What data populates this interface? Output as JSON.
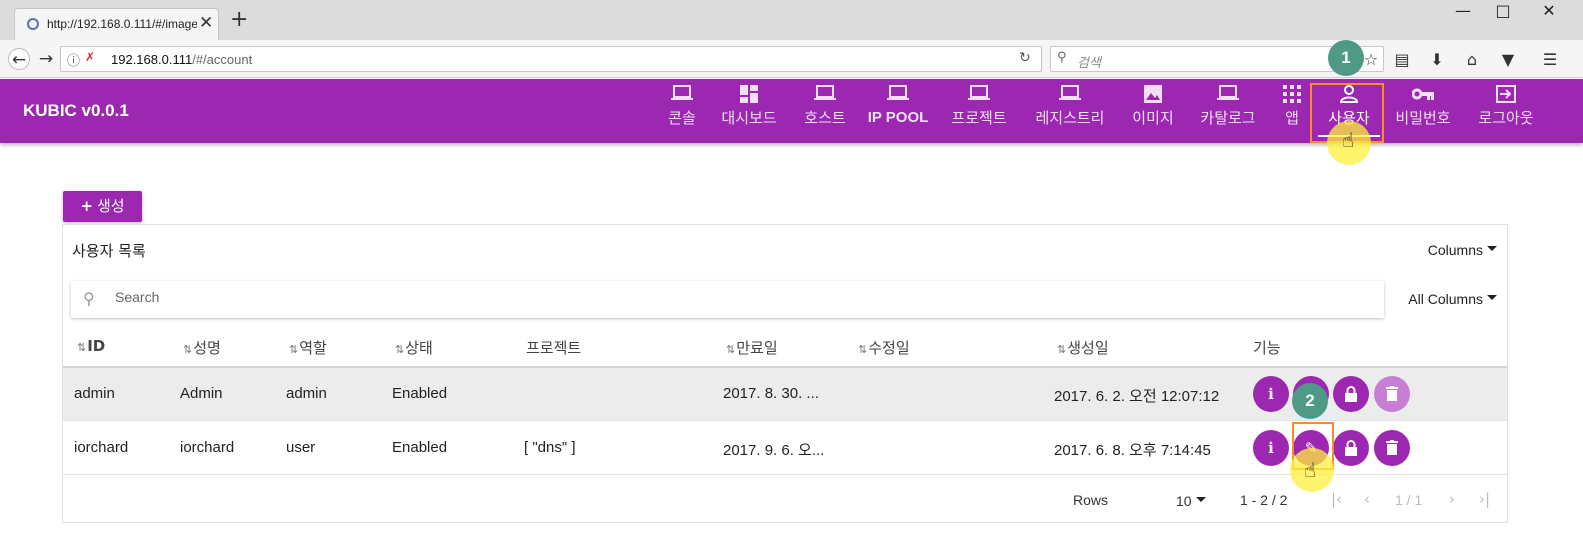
{
  "browser": {
    "tab_title": "http://192.168.0.111/#/image",
    "tab_close": "✕",
    "new_tab": "+",
    "url_host": "192.168.0.111",
    "url_path": "/#/account",
    "search_placeholder": "검색"
  },
  "app": {
    "title": "KUBIC v0.0.1",
    "menu": [
      {
        "label": "콘솔",
        "icon": "laptop-icon"
      },
      {
        "label": "대시보드",
        "icon": "dashboard-icon"
      },
      {
        "label": "호스트",
        "icon": "laptop-icon"
      },
      {
        "label": "IP POOL",
        "icon": "laptop-icon"
      },
      {
        "label": "프로젝트",
        "icon": "laptop-icon"
      },
      {
        "label": "레지스트리",
        "icon": "laptop-icon"
      },
      {
        "label": "이미지",
        "icon": "image-icon"
      },
      {
        "label": "카탈로그",
        "icon": "laptop-icon"
      },
      {
        "label": "앱",
        "icon": "apps-grid-icon"
      },
      {
        "label": "사용자",
        "icon": "person-icon"
      },
      {
        "label": "비밀번호",
        "icon": "key-icon"
      },
      {
        "label": "로그아웃",
        "icon": "logout-icon"
      }
    ],
    "active_menu": "사용자",
    "accent_color": "#9c27b0"
  },
  "annotations": {
    "step1": "1",
    "step2": "2",
    "highlight_color": "#ff8a2a"
  },
  "content": {
    "create_label": "생성",
    "list_title": "사용자 목록",
    "columns_label": "Columns",
    "search_placeholder": "Search",
    "all_columns_label": "All Columns",
    "headers": [
      "ID",
      "성명",
      "역할",
      "상태",
      "프로젝트",
      "만료일",
      "수정일",
      "생성일",
      "기능"
    ],
    "rows": [
      {
        "id": "admin",
        "name": "Admin",
        "role": "admin",
        "status": "Enabled",
        "project": "",
        "expires": "2017. 8. 30. ...",
        "modified": "",
        "created": "2017. 6. 2. 오전 12:07:12"
      },
      {
        "id": "iorchard",
        "name": "iorchard",
        "role": "user",
        "status": "Enabled",
        "project": "[ \"dns\" ]",
        "expires": "2017. 9. 6. 오...",
        "modified": "",
        "created": "2017. 6. 8. 오후 7:14:45"
      }
    ],
    "rows_label": "Rows",
    "rows_per_page": "10",
    "range_label": "1 - 2 / 2",
    "page_label": "1 / 1"
  }
}
